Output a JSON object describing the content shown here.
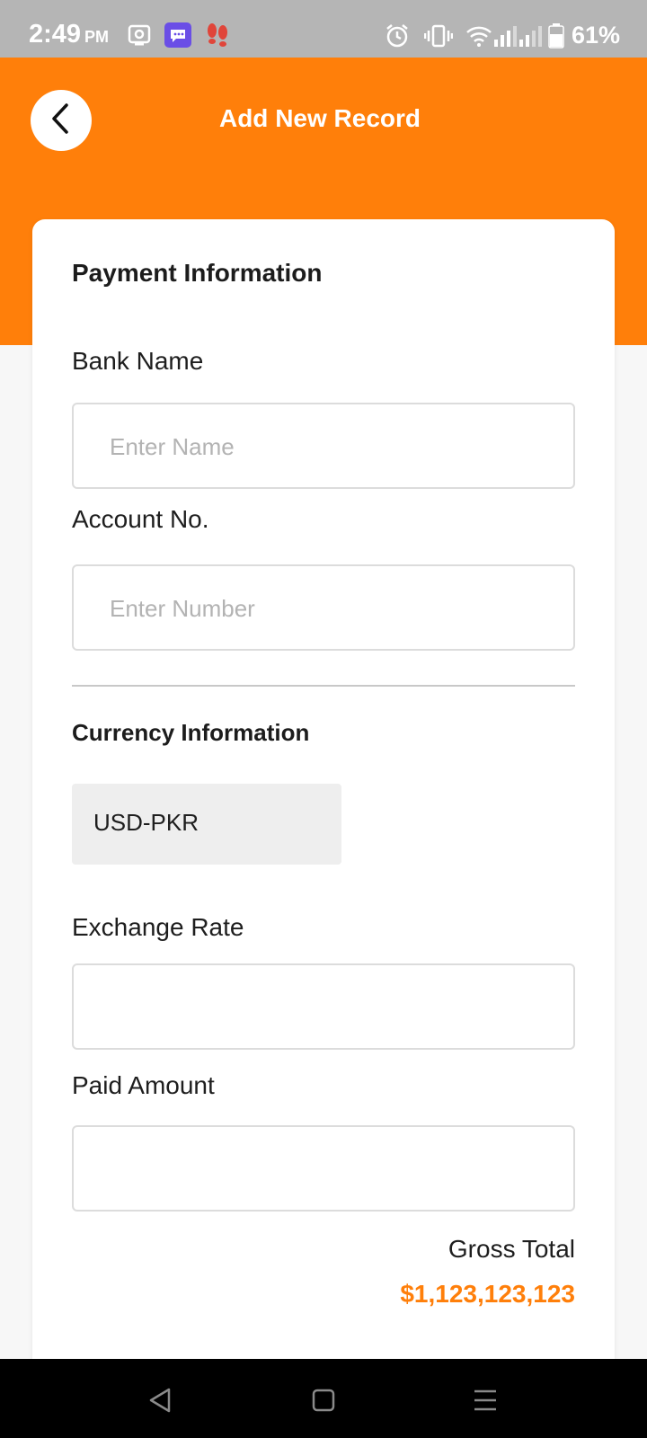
{
  "status_bar": {
    "time": "2:49",
    "ampm": "PM",
    "battery_percent": "61%",
    "icons": [
      "screen-recorder-icon",
      "messenger-icon",
      "footsteps-icon",
      "alarm-icon",
      "vibrate-icon",
      "wifi-icon",
      "signal-icon",
      "signal-icon-2",
      "battery-icon"
    ]
  },
  "header": {
    "title": "Add New Record",
    "back_icon": "chevron-left-icon",
    "background_color": "#ff7f0a"
  },
  "form": {
    "payment_section_title": "Payment Information",
    "bank_name": {
      "label": "Bank Name",
      "placeholder": "Enter Name",
      "value": ""
    },
    "account_no": {
      "label": "Account No.",
      "placeholder": "Enter Number",
      "value": ""
    },
    "currency_section_title": "Currency Information",
    "currency_pair": "USD-PKR",
    "exchange_rate": {
      "label": "Exchange Rate",
      "value": ""
    },
    "paid_amount": {
      "label": "Paid Amount",
      "value": ""
    },
    "gross_total_label": "Gross Total",
    "gross_total_value": "$1,123,123,123",
    "accent_color": "#ff7f0a"
  },
  "nav_bar": {
    "buttons": [
      "back-nav-icon",
      "home-nav-icon",
      "menu-nav-icon"
    ]
  }
}
